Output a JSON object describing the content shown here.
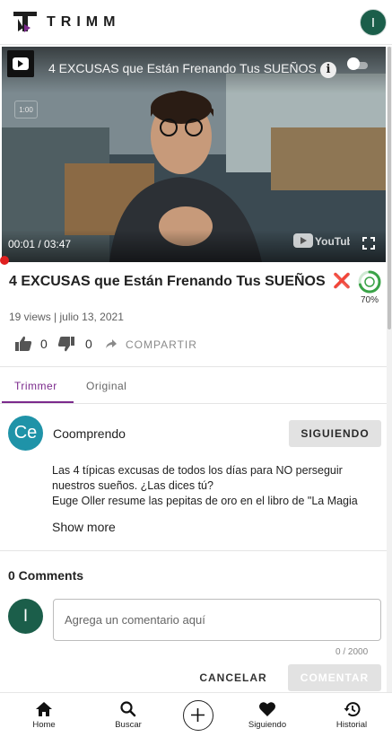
{
  "app": {
    "brand": "TRIMM",
    "user_initial": "I",
    "accent": "#7b2a8c"
  },
  "player": {
    "title": "4 EXCUSAS que Están Frenando Tus SUEÑOS 🤚",
    "quality_chip": "1:00",
    "time": "00:01 / 03:47",
    "watermark": "YouTube",
    "progress": 0.0044
  },
  "video": {
    "title": "4 EXCUSAS que Están Frenando Tus SUEÑOS",
    "title_emoji": "❌",
    "trim_percent": "70%",
    "trim_progress": 0.7,
    "views": "19 views",
    "date": "julio 13, 2021",
    "likes": "0",
    "dislikes": "0",
    "share_label": "COMPARTIR"
  },
  "tabs": [
    {
      "label": "Trimmer",
      "active": true
    },
    {
      "label": "Original",
      "active": false
    }
  ],
  "channel": {
    "initials": "Ce",
    "name": "Coomprendo",
    "follow_label": "SIGUIENDO"
  },
  "description": {
    "lines": [
      "Las 4 típicas excusas de todos los días para NO perseguir",
      "nuestros sueños. ¿Las dices tú?",
      "Euge Oller resume las pepitas de oro en el libro de \"La Magia"
    ],
    "show_more": "Show more"
  },
  "comments": {
    "title": "0 Comments",
    "user_initial": "I",
    "input_value": "",
    "placeholder": "Agrega un comentario aquí",
    "char_count": "0 / 2000",
    "cancel_label": "CANCELAR",
    "submit_label": "COMENTAR"
  },
  "nav": [
    {
      "label": "Home",
      "icon": "home-icon"
    },
    {
      "label": "Buscar",
      "icon": "search-icon"
    },
    {
      "label": "",
      "icon": "add-icon"
    },
    {
      "label": "Siguiendo",
      "icon": "heart-icon"
    },
    {
      "label": "Historial",
      "icon": "history-icon"
    }
  ]
}
